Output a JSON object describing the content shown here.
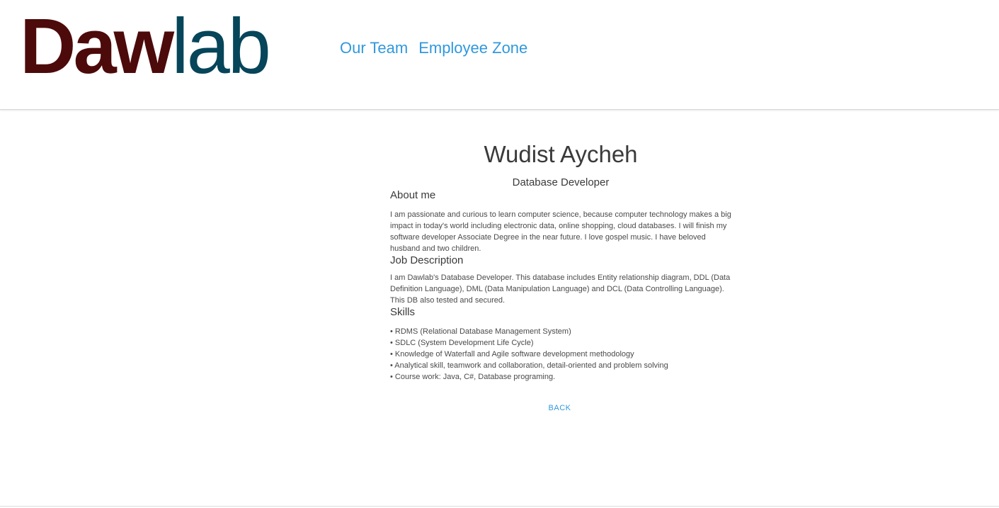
{
  "logo": {
    "part1": "Daw",
    "part2": "lab",
    "colors": {
      "part1": "#4d0a0a",
      "part2": "#06455a"
    }
  },
  "nav": {
    "items": [
      {
        "label": "Our Team"
      },
      {
        "label": "Employee Zone"
      }
    ],
    "color": "#3198dd"
  },
  "profile": {
    "name": "Wudist Aycheh",
    "role": "Database Developer",
    "about": {
      "title": "About me",
      "text": "I am passionate and curious to learn computer science, because computer technology makes a big impact in today's world including electronic data, online shopping, cloud databases. I will finish my software developer Associate Degree in the near future. I love gospel music. I have beloved husband and two children."
    },
    "job": {
      "title": "Job Description",
      "text": "I am Dawlab's Database Developer. This database includes Entity relationship diagram, DDL (Data Definition Language), DML (Data Manipulation Language) and DCL (Data Controlling Language). This DB also tested and secured."
    },
    "skills": {
      "title": "Skills",
      "items": [
        "• RDMS (Relational Database Management System)",
        "• SDLC (System Development Life Cycle)",
        "• Knowledge of Waterfall and Agile software development methodology",
        "• Analytical skill, teamwork and collaboration, detail-oriented and problem solving",
        "• Course work: Java, C#, Database programing."
      ]
    },
    "back_label": "BACK"
  }
}
